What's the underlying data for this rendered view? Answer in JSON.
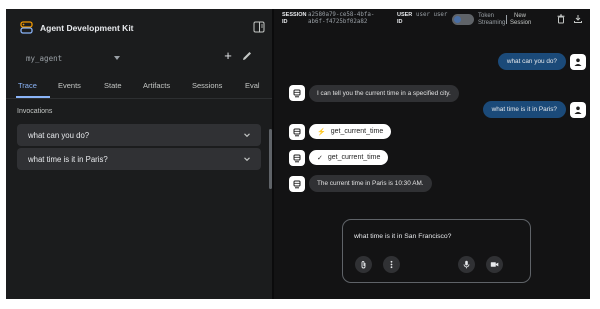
{
  "app": {
    "title": "Agent Development Kit"
  },
  "agent_selector": {
    "value": "my_agent"
  },
  "tabs": [
    {
      "label": "Trace",
      "active": true
    },
    {
      "label": "Events",
      "active": false
    },
    {
      "label": "State",
      "active": false
    },
    {
      "label": "Artifacts",
      "active": false
    },
    {
      "label": "Sessions",
      "active": false
    },
    {
      "label": "Eval",
      "active": false
    }
  ],
  "invocations": {
    "heading": "Invocations",
    "items": [
      {
        "label": "what can you do?"
      },
      {
        "label": "what time is it in Paris?"
      }
    ]
  },
  "session_bar": {
    "session_label_1": "SESSION",
    "session_label_2": "ID",
    "session_id_line1": "a2580a79-ce58-4bfa-",
    "session_id_line2": "ab6f-f4725bf02a82",
    "user_label_1": "USER",
    "user_label_2": "ID",
    "user_value": "user user",
    "streaming_line1": "Token",
    "streaming_line2": "Streaming",
    "new_session_line1": "New",
    "new_session_line2": "Session"
  },
  "chat": {
    "messages": [
      {
        "role": "user",
        "text": "what can you do?"
      },
      {
        "role": "bot",
        "text": "I can tell you the current time in a specified city."
      },
      {
        "role": "user",
        "text": "what time is it in Paris?"
      },
      {
        "role": "function_call",
        "symbol": "⚡",
        "text": "get_current_time"
      },
      {
        "role": "function_response",
        "symbol": "✓",
        "text": "get_current_time"
      },
      {
        "role": "bot",
        "text": "The current time in Paris is 10:30 AM."
      }
    ]
  },
  "composer": {
    "input_value": "what time is it in San Francisco?"
  },
  "colors": {
    "accent": "#8ab4f8",
    "user_bubble": "#1b4a79",
    "bot_bubble": "#303134",
    "background": "#131314",
    "panel": "#1b1c1d"
  }
}
